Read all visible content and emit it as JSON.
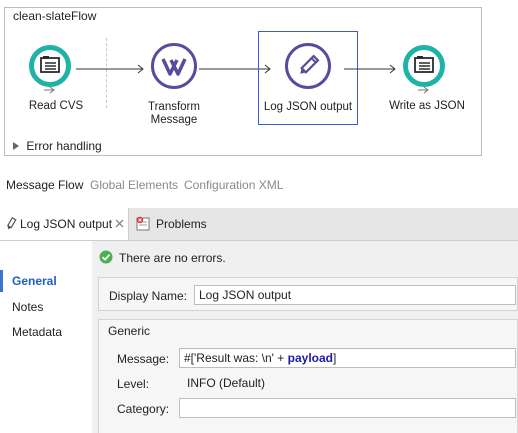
{
  "flow": {
    "title": "clean-slateFlow",
    "error_handling": "Error handling",
    "nodes": [
      {
        "label": "Read CVS",
        "icon": "file-read-icon"
      },
      {
        "label": "Transform\nMessage",
        "icon": "transform-icon"
      },
      {
        "label": "Log JSON output",
        "icon": "logger-pencil-icon"
      },
      {
        "label": "Write as JSON",
        "icon": "file-write-icon"
      }
    ]
  },
  "editor_tabs": {
    "message_flow": "Message Flow",
    "global_elements": "Global Elements",
    "configuration_xml": "Configuration XML"
  },
  "view_tabs": {
    "log_json_output": "Log JSON output",
    "problems": "Problems"
  },
  "status": {
    "text": "There are no errors."
  },
  "sidebar": {
    "items": [
      "General",
      "Notes",
      "Metadata"
    ],
    "active": "General"
  },
  "form": {
    "display_name_label": "Display Name:",
    "display_name_value": "Log JSON output",
    "group_title": "Generic",
    "message_label": "Message:",
    "message_prefix": "#['Result was: \\n' + ",
    "message_keyword": "payload",
    "message_suffix": "]",
    "level_label": "Level:",
    "level_value": "INFO (Default)",
    "category_label": "Category:",
    "category_value": ""
  },
  "colors": {
    "accent_teal": "#1fb2a6",
    "accent_purple": "#5b4a9e",
    "selection_blue": "#3b5bd0",
    "success_green": "#4caf50"
  }
}
